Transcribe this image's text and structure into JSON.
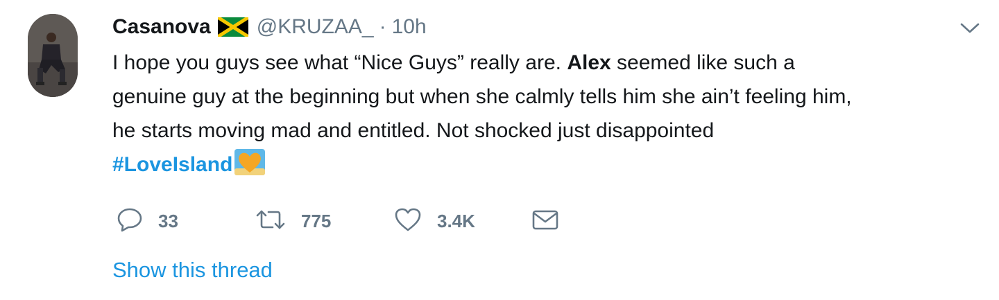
{
  "tweet": {
    "author": {
      "display_name": "Casanova",
      "flag": "jamaica-flag-icon",
      "handle": "@KRUZAA_",
      "separator": "·",
      "time": "10h"
    },
    "text": {
      "line1_before": "I hope you guys see what “Nice Guys” really are. ",
      "line1_bold": "Alex",
      "line1_after": " seemed like such a",
      "line2": "genuine guy at the beginning but when she calmly tells him she ain’t feeling him,",
      "line3": "he starts moving mad and entitled. Not shocked just disappointed",
      "hashtag": "#LoveIsland",
      "emoji": "love-island-heart-emoji"
    },
    "actions": {
      "replies": "33",
      "retweets": "775",
      "likes": "3.4K"
    },
    "show_thread": "Show this thread"
  },
  "colors": {
    "text": "#14171a",
    "secondary": "#657786",
    "link": "#1b95e0",
    "hashtag_emoji": "#f5a623"
  }
}
